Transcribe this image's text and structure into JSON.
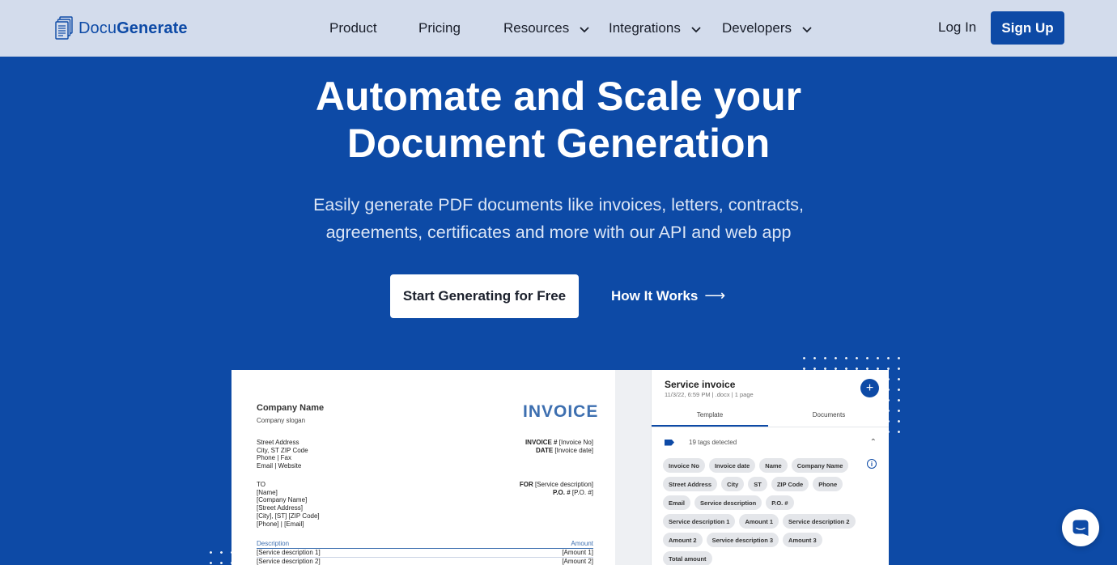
{
  "nav": {
    "logo_part1": "Docu",
    "logo_part2": "Generate",
    "items": [
      {
        "label": "Product",
        "dropdown": false
      },
      {
        "label": "Pricing",
        "dropdown": false
      },
      {
        "label": "Resources",
        "dropdown": true
      },
      {
        "label": "Integrations",
        "dropdown": true
      },
      {
        "label": "Developers",
        "dropdown": true
      }
    ],
    "login": "Log In",
    "signup": "Sign Up"
  },
  "hero": {
    "title_line1": "Automate and Scale your",
    "title_line2": "Document Generation",
    "subtitle_line1": "Easily generate PDF documents like invoices, letters, contracts,",
    "subtitle_line2": "agreements, certificates and more with our API and web app",
    "cta_primary": "Start Generating for Free",
    "cta_secondary": "How It Works",
    "cta_secondary_arrow": "⟶"
  },
  "invoice": {
    "company_name": "Company Name",
    "company_slogan": "Company slogan",
    "heading": "INVOICE",
    "address_lines": [
      "Street Address",
      "City, ST ZIP Code",
      "Phone | Fax",
      "Email | Website"
    ],
    "invoice_no_label": "INVOICE #",
    "invoice_no_value": "[Invoice No]",
    "date_label": "DATE",
    "date_value": "[Invoice date]",
    "to_lines": [
      "TO",
      "[Name]",
      "[Company Name]",
      "[Street Address]",
      "[City], [ST] [ZIP Code]",
      "[Phone] | [Email]"
    ],
    "for_label": "FOR",
    "for_value": "[Service description]",
    "po_label": "P.O. #",
    "po_value": "[P.O. #]",
    "table_header_desc": "Description",
    "table_header_amount": "Amount",
    "rows": [
      {
        "desc": "[Service description 1]",
        "amount": "[Amount 1]"
      },
      {
        "desc": "[Service description 2]",
        "amount": "[Amount 2]"
      }
    ]
  },
  "panel": {
    "title": "Service invoice",
    "meta": "11/3/22, 6:59 PM | .docx | 1 page",
    "tab_template": "Template",
    "tab_documents": "Documents",
    "tags_detected": "19 tags detected",
    "collapse_icon": "⌃",
    "info_icon": "i",
    "plus_icon": "+",
    "chips": [
      "Invoice No",
      "Invoice date",
      "Name",
      "Company Name",
      "Street Address",
      "City",
      "ST",
      "ZIP Code",
      "Phone",
      "Email",
      "Service description",
      "P.O. #",
      "Service description 1",
      "Amount 1",
      "Service description 2",
      "Amount 2",
      "Service description 3",
      "Amount 3",
      "Total amount"
    ]
  },
  "colors": {
    "brand": "#0d4aa6",
    "nav_bg": "#d3dcec",
    "invoice_heading": "#3d6fb0"
  },
  "icons": {
    "logo": "document-stack-icon",
    "chevrons": "chevron-down-icon",
    "chat": "chat-icon",
    "tag": "tag-icon"
  }
}
